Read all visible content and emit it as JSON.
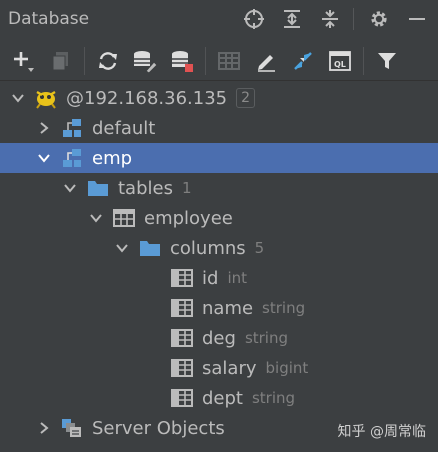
{
  "panel": {
    "title": "Database"
  },
  "tree": {
    "connection": {
      "label": "@192.168.36.135",
      "badge": "2"
    },
    "default_schema": {
      "label": "default"
    },
    "emp_schema": {
      "label": "emp"
    },
    "tables": {
      "label": "tables",
      "count": "1"
    },
    "employee": {
      "label": "employee"
    },
    "columns": {
      "label": "columns",
      "count": "5"
    },
    "column_list": [
      {
        "name": "id",
        "type": "int"
      },
      {
        "name": "name",
        "type": "string"
      },
      {
        "name": "deg",
        "type": "string"
      },
      {
        "name": "salary",
        "type": "bigint"
      },
      {
        "name": "dept",
        "type": "string"
      }
    ],
    "server_objects": {
      "label": "Server Objects"
    }
  },
  "watermark": "知乎 @周常临",
  "colors": {
    "selection": "#4b6eaf",
    "folder": "#5a9bd5",
    "background": "#3c3f41"
  }
}
